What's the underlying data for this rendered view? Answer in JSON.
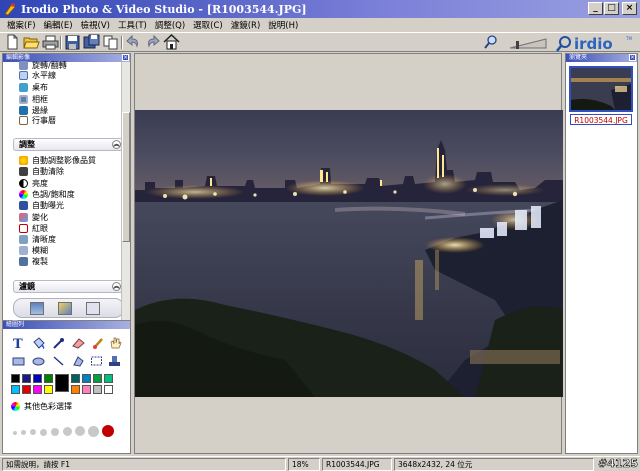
{
  "window": {
    "title": "Irodio Photo & Video Studio - [R1003544.JPG]"
  },
  "menu": [
    "檔案(F)",
    "編輯(E)",
    "檢視(V)",
    "工具(T)",
    "調整(Q)",
    "選取(C)",
    "濾鏡(R)",
    "說明(H)"
  ],
  "left_panel": {
    "caption": "編輯影像",
    "list_top": [
      "旋轉/翻轉",
      "水平線",
      "桌布",
      "相框",
      "邊緣",
      "行事曆"
    ],
    "section_adjust": "調整",
    "adjust_items": [
      "自動調整影像品質",
      "自動清除",
      "亮度",
      "色調/飽和度",
      "自動曝光",
      "變化",
      "紅眼",
      "清晰度",
      "模糊",
      "複製"
    ],
    "section_effects": "濾鏡"
  },
  "tools_panel": {
    "caption": "繪圖列",
    "more_colors": "其他色彩選擇",
    "palette": [
      "#000000",
      "#1a1a80",
      "#0000c0",
      "#008000",
      "#006060",
      "#0080c0",
      "#00a040",
      "#00c080",
      "#00c0ff",
      "#e00000",
      "#ff00ff",
      "#ffff00",
      "#ff8000",
      "#ff80c0",
      "#c0c0c0",
      "#ffffff"
    ]
  },
  "right_panel": {
    "caption": "瀏覽夾",
    "thumbnail_label": "R1003544.JPG"
  },
  "status": {
    "help": "如需說明，請按 F1",
    "zoom": "18%",
    "filename": "R1003544.JPG",
    "dimensions": "3648x2432, 24 位元",
    "watermark": "#4125"
  },
  "brand": "irdio"
}
